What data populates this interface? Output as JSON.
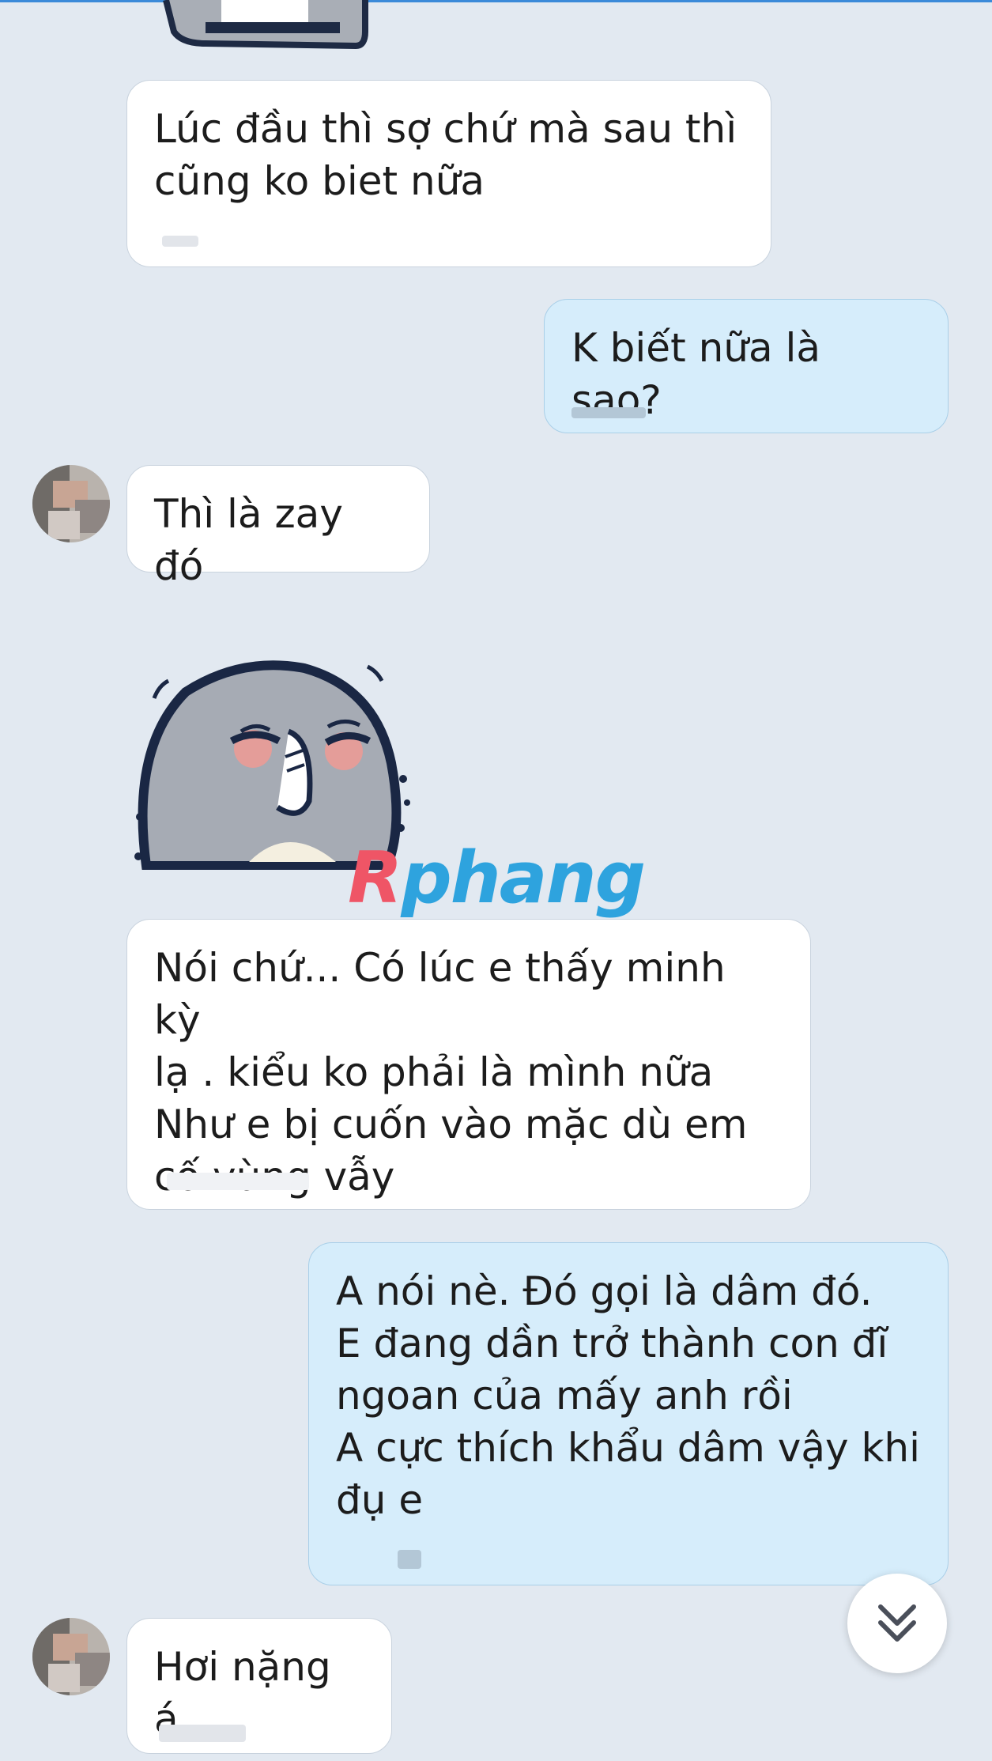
{
  "watermark": {
    "part1": "R",
    "part2": "phang"
  },
  "messages": [
    {
      "id": "m1",
      "from": "them",
      "text": "Lúc đầu thì sợ chứ mà sau thì\ncũng ko biet nữa"
    },
    {
      "id": "m2",
      "from": "me",
      "text": "K biết nữa là sao?"
    },
    {
      "id": "m3",
      "from": "them",
      "text": "Thì là zay đó"
    },
    {
      "id": "m4",
      "from": "them",
      "type": "sticker",
      "icon": "gray-blob-sticker-shy"
    },
    {
      "id": "m5",
      "from": "them",
      "text": "Nói chứ... Có lúc e thấy minh kỳ\nlạ . kiểu ko phải là mình nữa\nNhư e bị cuốn vào mặc dù em\ncố vùng vẫy"
    },
    {
      "id": "m6",
      "from": "me",
      "text": "A nói nè. Đó gọi là dâm đó.\nE đang dần trở thành con đĩ\nngoan của mấy anh rồi\nA cực thích khẩu dâm vậy khi\nđụ e"
    },
    {
      "id": "m7",
      "from": "them",
      "text": "Hơi nặng á"
    }
  ],
  "scroll_down_icon": "double-chevron-down-icon",
  "colors": {
    "background": "#e2e9f1",
    "incoming_bubble": "#ffffff",
    "outgoing_bubble": "#d6edfb",
    "accent": "#3b8ad9"
  }
}
